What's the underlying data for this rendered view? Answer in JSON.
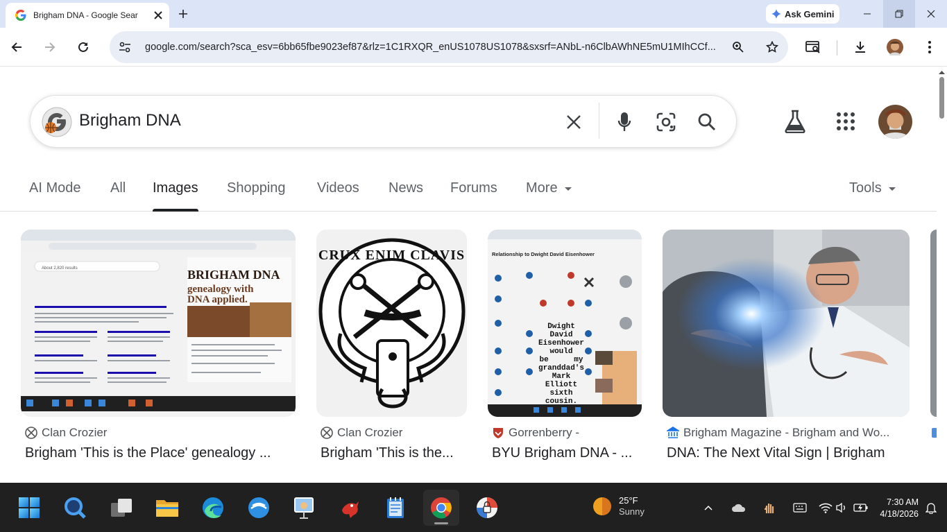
{
  "browser": {
    "tab_title": "Brigham DNA - Google Sear",
    "gemini_label": "Ask Gemini",
    "url": "google.com/search?sca_esv=6bb65fbe9023ef87&rlz=1C1RXQR_enUS1078US1078&sxsrf=ANbL-n6ClbAWhNE5mU1MIhCCf..."
  },
  "search": {
    "query": "Brigham DNA"
  },
  "nav_tabs": [
    {
      "label": "AI Mode"
    },
    {
      "label": "All"
    },
    {
      "label": "Images",
      "active": true
    },
    {
      "label": "Shopping"
    },
    {
      "label": "Videos"
    },
    {
      "label": "News"
    },
    {
      "label": "Forums"
    },
    {
      "label": "More"
    }
  ],
  "tools_label": "Tools",
  "results": [
    {
      "source": "Clan Crozier",
      "title": "Brigham 'This is the Place' genealogy ..."
    },
    {
      "source": "Clan Crozier",
      "title": "Brigham 'This is the..."
    },
    {
      "source": "Gorrenberry -",
      "title": "BYU Brigham DNA - ..."
    },
    {
      "source": "Brigham Magazine - Brigham and Wo...",
      "title": "DNA: The Next Vital Sign | Brigham"
    }
  ],
  "image_texts": {
    "r1_logo1": "BRIGHAM DNA",
    "r1_logo2": "genealogy with",
    "r1_logo3": "DNA applied.",
    "r1_results": "About 2,820 results",
    "r2_motto": "CRUX ENIM CLAVIS",
    "r3_heading": "Relationship to Dwight David Eisenhower",
    "r3_caption": "Dwight David Eisenhower would be my granddad's Mark Elliott sixth cousin."
  },
  "taskbar": {
    "weather_temp": "25°F",
    "weather_desc": "Sunny",
    "time": "7:30 AM",
    "date": "4/18/2026"
  },
  "colors": {
    "title_bar": "#dbe5f7",
    "omnibox": "#e9eef6",
    "taskbar": "#202020",
    "active_tab_underline": "#202124"
  }
}
